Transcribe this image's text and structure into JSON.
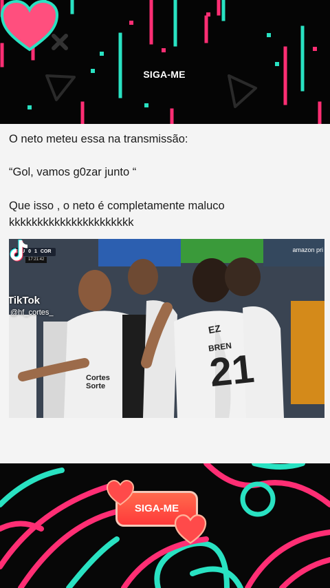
{
  "top_banner": {
    "follow_label": "SIGA-ME",
    "accent_pink": "#ff2e74",
    "accent_teal": "#29e2c2",
    "badge_color": "#ff4f7e"
  },
  "post": {
    "line1": "O neto meteu essa na transmissão:",
    "line2": "“Gol, vamos g0zar junto “",
    "line3": " Que isso , o neto é completamente maluco",
    "line4": "kkkkkkkkkkkkkkkkkkkkkk"
  },
  "video": {
    "scoreboard": {
      "home_team": "CRU",
      "home_score": "0",
      "away_score": "1",
      "away_team": "COR"
    },
    "match_clock": "17:21:42",
    "broadcaster": "amazon pri",
    "tiktok_word": "TikTok",
    "tiktok_handle": "@hf_cortes_",
    "jersey_number": "21",
    "jersey_name": "BREN",
    "jersey_name_top": "EZ",
    "sponsor": "Cortes Sorte"
  },
  "bottom_banner": {
    "follow_label": "SIGA-ME",
    "pill_color": "#ff4a40",
    "heart_color": "#ff4a4a"
  }
}
